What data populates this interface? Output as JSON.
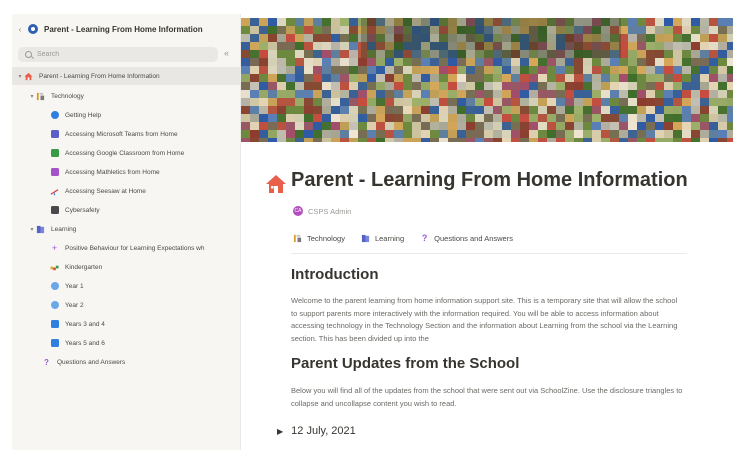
{
  "sidebar": {
    "workspace_title": "Parent - Learning From Home Information",
    "search_placeholder": "Search",
    "collapse_glyph": "«",
    "items": [
      {
        "label": "Parent - Learning From Home Information",
        "icon": "house-icon"
      },
      {
        "label": "Technology",
        "icon": "tools-icon"
      },
      {
        "label": "Getting Help",
        "icon": "help-circle-icon"
      },
      {
        "label": "Accessing Microsoft Teams from Home",
        "icon": "teams-icon"
      },
      {
        "label": "Accessing Google Classroom from Home",
        "icon": "classroom-icon"
      },
      {
        "label": "Accessing Mathletics from Home",
        "icon": "mathletics-icon"
      },
      {
        "label": "Accessing Seesaw at Home",
        "icon": "seesaw-icon"
      },
      {
        "label": "Cybersafety",
        "icon": "cybersafety-icon"
      },
      {
        "label": "Learning",
        "icon": "books-icon"
      },
      {
        "label": "Positive Behaviour for Learning Expectations wh",
        "icon": "sparkle-icon"
      },
      {
        "label": "Kindergarten",
        "icon": "abc-blocks-icon"
      },
      {
        "label": "Year 1",
        "icon": "year1-icon"
      },
      {
        "label": "Year 2",
        "icon": "year2-icon"
      },
      {
        "label": "Years 3 and 4",
        "icon": "years34-icon"
      },
      {
        "label": "Years 5 and 6",
        "icon": "years56-icon"
      },
      {
        "label": "Questions and Answers",
        "icon": "question-icon"
      }
    ]
  },
  "page": {
    "title": "Parent - Learning From Home Information",
    "author": "CSPS Admin",
    "avatar_initials": "CA",
    "links": [
      {
        "label": "Technology",
        "icon": "tools-icon"
      },
      {
        "label": "Learning",
        "icon": "books-icon"
      },
      {
        "label": "Questions and Answers",
        "icon": "question-icon"
      }
    ],
    "intro_heading": "Introduction",
    "intro_text": "Welcome to the parent learning from home information support site. This is a temporary site that will allow the school to support parents more interactively with the information required. You will be able to access information about accessing technology in the Technology Section and the information about Learning from the school via the Learning section. This has been divided up into the",
    "updates_heading": "Parent Updates from the School",
    "updates_text": "Below you will find all of the updates from the school that were sent out via SchoolZine. Use the disclosure triangles to collapse and uncollapse content you wish to read.",
    "toggle_date": "12 July, 2021"
  },
  "colors": {
    "sidebar_bg": "#f7f6f3",
    "accent_blue": "#2f7fe0",
    "accent_purple": "#9b59d0",
    "avatar": "#b34fbd"
  }
}
